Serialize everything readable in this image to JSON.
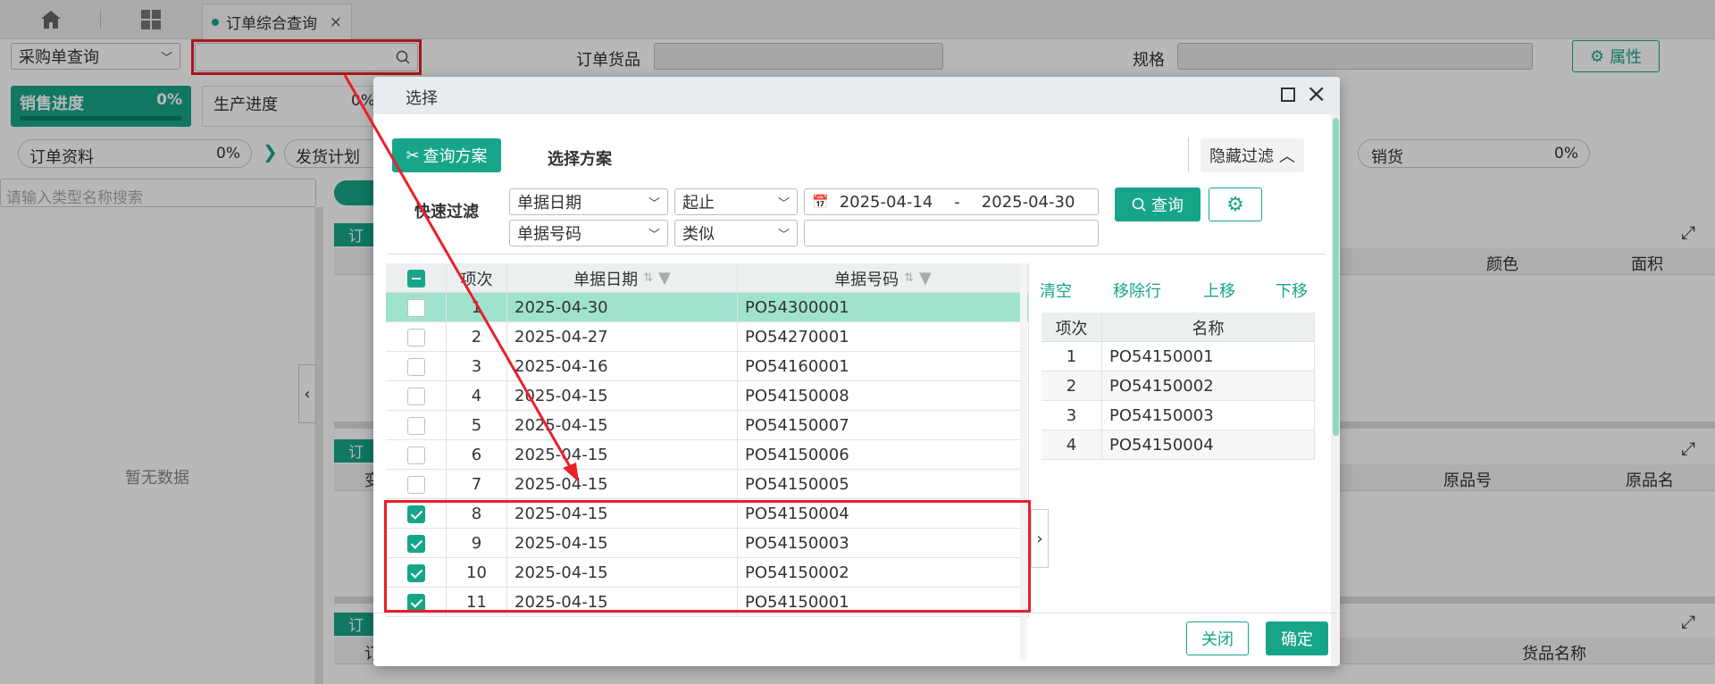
{
  "tabs": {
    "active_label": "订单综合查询",
    "close": "×"
  },
  "filter": {
    "query_type": "采购单查询",
    "search_value": "",
    "goods_label": "订单货品",
    "spec_label": "规格",
    "attr_button": "属性"
  },
  "progress": [
    {
      "label": "销售进度",
      "pct": "0%"
    },
    {
      "label": "生产进度",
      "pct": "0%"
    }
  ],
  "steps": [
    {
      "label": "订单资料",
      "pct": "0%"
    },
    {
      "label": "发货计划",
      "pct": ""
    },
    {
      "label": "销货",
      "pct": "0%"
    }
  ],
  "left_panel": {
    "search_placeholder": "请输入类型名称搜索",
    "empty_text": "暂无数据"
  },
  "bg_sections": [
    {
      "tag": "订",
      "cols": [
        "颜色",
        "面积"
      ]
    },
    {
      "tag": "订",
      "cols": [
        "原品号",
        "原品名"
      ],
      "extra": "变"
    },
    {
      "tag": "订",
      "cols": [
        "货品名称"
      ],
      "extra": "订"
    }
  ],
  "dialog": {
    "title": "选择",
    "tab_active": "查询方案",
    "tab_other": "选择方案",
    "hide_filter": "隐藏过滤",
    "quick_filter_label": "快速过滤",
    "filter1_field": "单据日期",
    "filter1_op": "起止",
    "date_from": "2025-04-14",
    "date_sep": "-",
    "date_to": "2025-04-30",
    "filter2_field": "单据号码",
    "filter2_op": "类似",
    "filter2_value": "",
    "query_button": "查询",
    "grid_headers": [
      "项次",
      "单据日期",
      "单据号码"
    ],
    "grid_rows": [
      {
        "no": "1",
        "date": "2025-04-30",
        "code": "PO54300001",
        "checked": false,
        "highlight": true
      },
      {
        "no": "2",
        "date": "2025-04-27",
        "code": "PO54270001",
        "checked": false,
        "highlight": false
      },
      {
        "no": "3",
        "date": "2025-04-16",
        "code": "PO54160001",
        "checked": false,
        "highlight": false
      },
      {
        "no": "4",
        "date": "2025-04-15",
        "code": "PO54150008",
        "checked": false,
        "highlight": false
      },
      {
        "no": "5",
        "date": "2025-04-15",
        "code": "PO54150007",
        "checked": false,
        "highlight": false
      },
      {
        "no": "6",
        "date": "2025-04-15",
        "code": "PO54150006",
        "checked": false,
        "highlight": false
      },
      {
        "no": "7",
        "date": "2025-04-15",
        "code": "PO54150005",
        "checked": false,
        "highlight": false
      },
      {
        "no": "8",
        "date": "2025-04-15",
        "code": "PO54150004",
        "checked": true,
        "highlight": false
      },
      {
        "no": "9",
        "date": "2025-04-15",
        "code": "PO54150003",
        "checked": true,
        "highlight": false
      },
      {
        "no": "10",
        "date": "2025-04-15",
        "code": "PO54150002",
        "checked": true,
        "highlight": false
      },
      {
        "no": "11",
        "date": "2025-04-15",
        "code": "PO54150001",
        "checked": true,
        "highlight": false
      }
    ],
    "right_actions": [
      "清空",
      "移除行",
      "上移",
      "下移"
    ],
    "right_headers": [
      "项次",
      "名称"
    ],
    "right_rows": [
      {
        "no": "1",
        "name": "PO54150001"
      },
      {
        "no": "2",
        "name": "PO54150002"
      },
      {
        "no": "3",
        "name": "PO54150003"
      },
      {
        "no": "4",
        "name": "PO54150004"
      }
    ],
    "close_button": "关闭",
    "ok_button": "确定"
  },
  "colors": {
    "accent": "#17a589",
    "annotation": "#e8202a",
    "row_highlight": "#9fe3cf"
  }
}
